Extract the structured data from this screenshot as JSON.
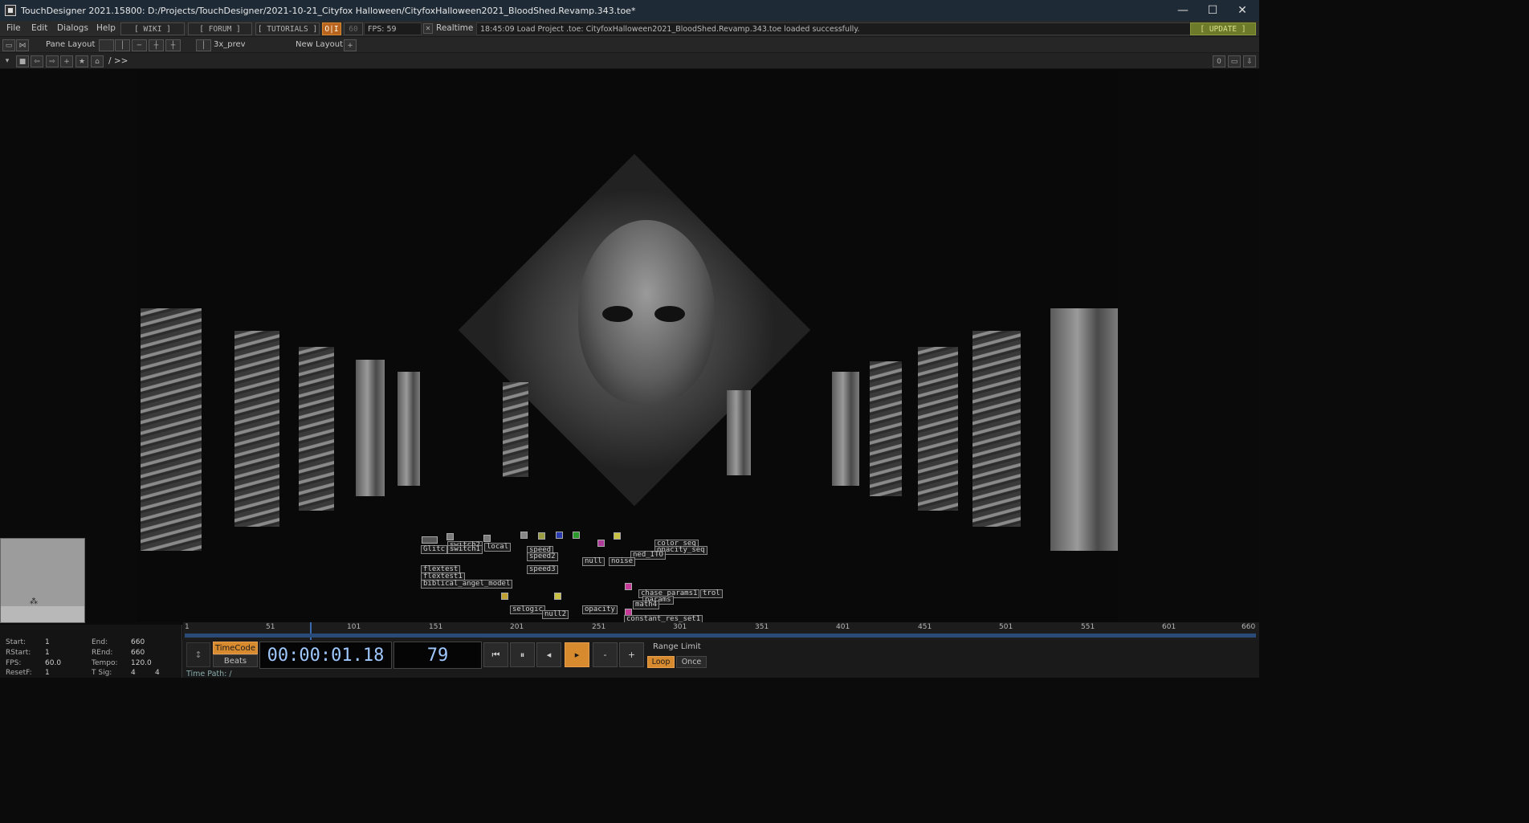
{
  "window": {
    "title": "TouchDesigner 2021.15800: D:/Projects/TouchDesigner/2021-10-21_Cityfox Halloween/CityfoxHalloween2021_BloodShed.Revamp.343.toe*",
    "minimize": "—",
    "maximize": "☐",
    "close": "✕"
  },
  "menubar": {
    "items": [
      "File",
      "Edit",
      "Dialogs",
      "Help"
    ],
    "wiki": "[ WIKI ]",
    "forum": "[ FORUM ]",
    "tutorials": "[ TUTORIALS ]",
    "oi": "O|I",
    "fps_target": "60",
    "fps": "FPS: 59",
    "realtime": "Realtime",
    "status": "18:45:09 Load Project .toe: CityfoxHalloween2021_BloodShed.Revamp.343.toe loaded successfully.",
    "update": "[ UPDATE ]"
  },
  "panebar": {
    "pane_layout": "Pane Layout",
    "layout_name": "3x_prev",
    "new_layout": "New Layout",
    "plus": "+"
  },
  "pathbar": {
    "path": "/ >>",
    "counter": "0"
  },
  "network_nodes": [
    "Glitc",
    "switch2",
    "switch1",
    "local",
    "color_seq",
    "opacity_seq",
    "ned_ITO",
    "noise",
    "null",
    "speed",
    "speed2",
    "speed3",
    "flextest",
    "flextest1",
    "biblical_angel_model",
    "chase params1",
    "trol",
    "params",
    "math4",
    "constant_res_set1",
    "selogic",
    "null2",
    "opacity"
  ],
  "timeline": {
    "ticks": [
      "1",
      "51",
      "101",
      "151",
      "201",
      "251",
      "301",
      "351",
      "401",
      "451",
      "501",
      "551",
      "601",
      "660"
    ],
    "playhead_frame": 79
  },
  "info": {
    "start_label": "Start:",
    "start": "1",
    "end_label": "End:",
    "end": "660",
    "rstart_label": "RStart:",
    "rstart": "1",
    "rend_label": "REnd:",
    "rend": "660",
    "fps_label": "FPS:",
    "fps": "60.0",
    "tempo_label": "Tempo:",
    "tempo": "120.0",
    "resetf_label": "ResetF:",
    "resetf": "1",
    "tsig_label": "T Sig:",
    "tsig_a": "4",
    "tsig_b": "4"
  },
  "transport": {
    "timecode_btn": "TimeCode",
    "beats_btn": "Beats",
    "timecode": "00:00:01.18",
    "frame": "79",
    "minus": "-",
    "plus": "+",
    "range_limit": "Range Limit",
    "loop": "Loop",
    "once": "Once",
    "time_path": "Time Path: /"
  },
  "colors": {
    "accent_orange": "#d88a2e",
    "titlebar": "#1e2a36",
    "update": "#6d7a2a"
  }
}
